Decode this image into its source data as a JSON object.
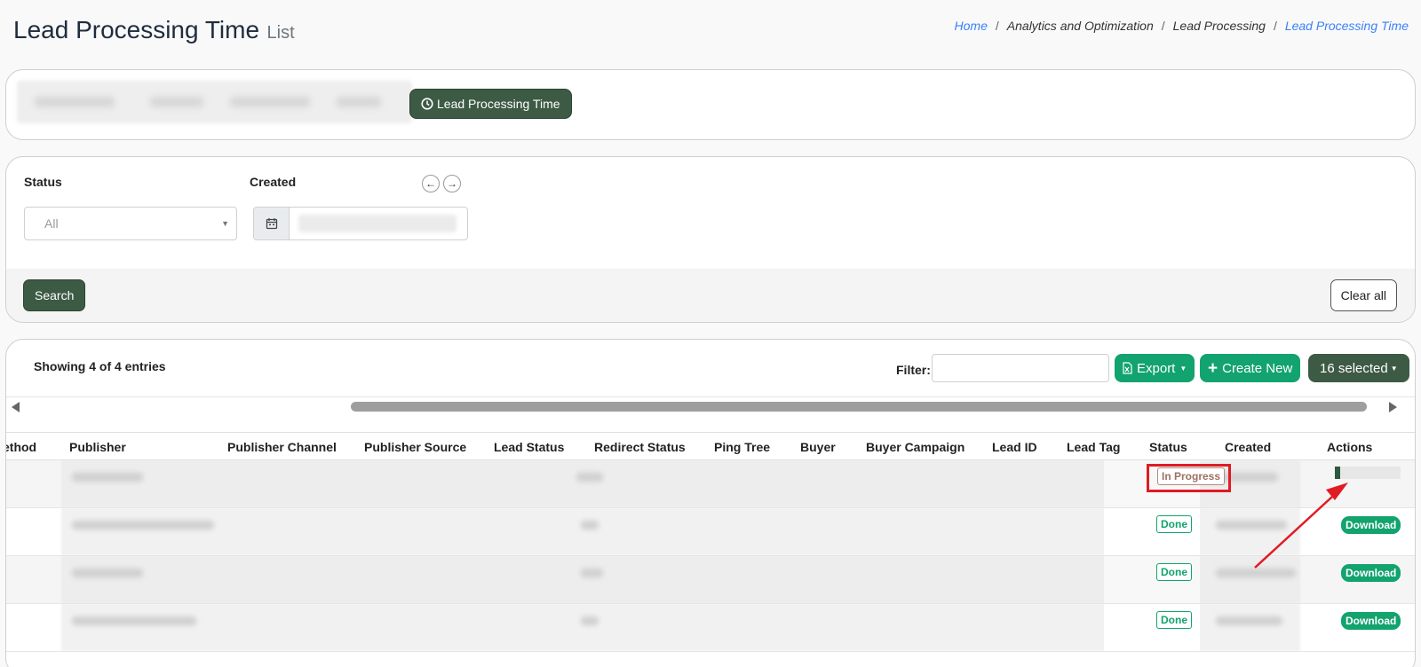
{
  "header": {
    "title": "Lead Processing Time",
    "subtitle": "List",
    "breadcrumb": [
      "Home",
      "Analytics and Optimization",
      "Lead Processing",
      "Lead Processing Time"
    ]
  },
  "tabs": {
    "active_label": "Lead Processing Time",
    "active_icon": "clock-icon"
  },
  "filters": {
    "status_label": "Status",
    "status_value": "All",
    "created_label": "Created",
    "search_button": "Search",
    "clear_button": "Clear all"
  },
  "table_toolbar": {
    "entries_text": "Showing 4 of 4 entries",
    "filter_label": "Filter:",
    "export_button": "Export",
    "create_button": "Create New",
    "selected_button": "16 selected"
  },
  "table": {
    "columns": [
      "ethod",
      "Publisher",
      "Publisher Channel",
      "Publisher Source",
      "Lead Status",
      "Redirect Status",
      "Ping Tree",
      "Buyer",
      "Buyer Campaign",
      "Lead ID",
      "Lead Tag",
      "Status",
      "Created",
      "Actions"
    ],
    "rows": [
      {
        "status": "In Progress",
        "action": "progress",
        "progress": 0.08
      },
      {
        "status": "Done",
        "action": "Download"
      },
      {
        "status": "Done",
        "action": "Download"
      },
      {
        "status": "Done",
        "action": "Download"
      }
    ]
  },
  "colors": {
    "primary_dark": "#3d5a45",
    "primary_green": "#12a36e",
    "highlight_red": "#e01b24",
    "link_blue": "#3b82f6"
  }
}
